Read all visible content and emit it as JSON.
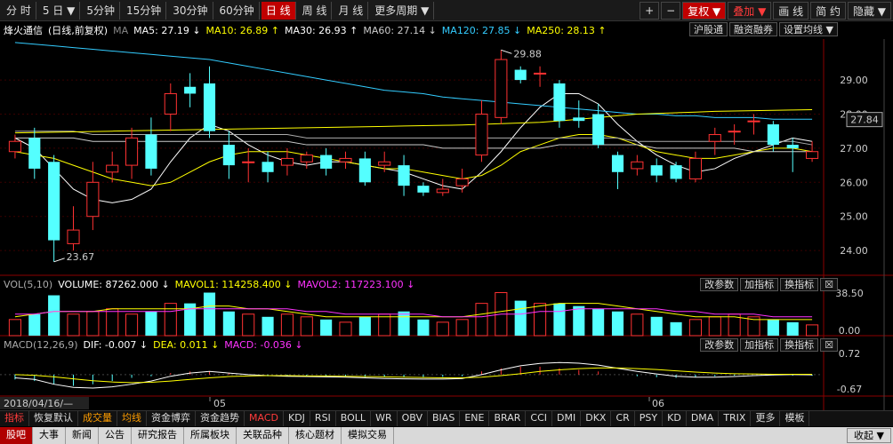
{
  "toolbar": {
    "periods": [
      "分 时",
      "5 日 ▼",
      "5分钟",
      "15分钟",
      "30分钟",
      "60分钟",
      "日 线",
      "周 线",
      "月 线",
      "更多周期 ▼"
    ],
    "active_period_index": 6,
    "right": [
      "+",
      "−",
      "复权 ▼",
      "叠加 ▼",
      "画 线",
      "简 约",
      "隐藏 ▼"
    ]
  },
  "ma": {
    "stock_name": "烽火通信",
    "mode": "(日线,前复权)",
    "ma_tag": "MA",
    "items": [
      {
        "label": "MA5: 27.19 ↓",
        "color": "#ffffff"
      },
      {
        "label": "MA10: 26.89 ↑",
        "color": "#ffff00"
      },
      {
        "label": "MA30: 26.93 ↑",
        "color": "#ffffff"
      },
      {
        "label": "MA60: 27.14 ↓",
        "color": "#cccccc"
      },
      {
        "label": "MA120: 27.85 ↓",
        "color": "#33ccff"
      },
      {
        "label": "MA250: 28.13 ↑",
        "color": "#ffff00"
      }
    ],
    "buttons": [
      "沪股通",
      "融资融券",
      "设置均线 ▼"
    ]
  },
  "price_axis": {
    "ticks": [
      {
        "value": 29.0,
        "label": "29.00"
      },
      {
        "value": 28.0,
        "label": "28.00"
      },
      {
        "value": 27.0,
        "label": "27.00"
      },
      {
        "value": 26.0,
        "label": "26.00"
      },
      {
        "value": 25.0,
        "label": "25.00"
      },
      {
        "value": 24.0,
        "label": "24.00"
      }
    ],
    "current": "27.84",
    "current_value": 27.84,
    "high_label": "29.88",
    "high_value": 29.88,
    "low_label": "23.67",
    "low_value": 23.67
  },
  "volume": {
    "title": "VOL(5,10)",
    "volume": "VOLUME: 87262.000 ↓",
    "mavol1": "MAVOL1: 114258.400 ↓",
    "mavol2": "MAVOL2: 117223.100 ↓",
    "axis_top": "38.50",
    "axis_bottom": "0.00",
    "buttons": [
      "改参数",
      "加指标",
      "换指标",
      "☒"
    ]
  },
  "macd": {
    "title": "MACD(12,26,9)",
    "dif": "DIF: -0.007 ↓",
    "dea": "DEA: 0.011 ↓",
    "macd": "MACD: -0.036 ↓",
    "axis_top": "0.72",
    "axis_bottom": "-0.67",
    "buttons": [
      "改参数",
      "加指标",
      "换指标",
      "☒"
    ]
  },
  "date_axis": {
    "date": "2018/04/16/—",
    "month1": "05",
    "month2": "06"
  },
  "tabs": [
    "指标",
    "恢复默认",
    "成交量",
    "均线",
    "资金博弈",
    "资金趋势",
    "MACD",
    "KDJ",
    "RSI",
    "BOLL",
    "WR",
    "OBV",
    "BIAS",
    "ENE",
    "BRAR",
    "CCI",
    "DMI",
    "DKX",
    "CR",
    "PSY",
    "KD",
    "DMA",
    "TRIX",
    "更多",
    "模板"
  ],
  "bottom": [
    "股吧",
    "大事",
    "新闻",
    "公告",
    "研究报告",
    "所属板块",
    "关联品种",
    "核心题材",
    "模拟交易"
  ],
  "bottom_right": [
    "收起 ▼"
  ],
  "chart_data": {
    "type": "candlestick",
    "ylim": [
      23.3,
      30.2
    ],
    "candles": [
      {
        "o": 26.9,
        "c": 27.2,
        "h": 27.4,
        "l": 26.7
      },
      {
        "o": 27.3,
        "c": 26.4,
        "h": 27.6,
        "l": 26.1
      },
      {
        "o": 26.6,
        "c": 24.3,
        "h": 26.8,
        "l": 23.67
      },
      {
        "o": 24.2,
        "c": 24.6,
        "h": 25.3,
        "l": 24.0
      },
      {
        "o": 25.0,
        "c": 26.0,
        "h": 26.6,
        "l": 24.6
      },
      {
        "o": 26.3,
        "c": 26.5,
        "h": 26.9,
        "l": 26.0
      },
      {
        "o": 26.5,
        "c": 27.3,
        "h": 27.6,
        "l": 26.1
      },
      {
        "o": 27.4,
        "c": 26.4,
        "h": 27.9,
        "l": 26.2
      },
      {
        "o": 28.0,
        "c": 28.6,
        "h": 28.9,
        "l": 27.5
      },
      {
        "o": 28.8,
        "c": 28.6,
        "h": 29.2,
        "l": 28.2
      },
      {
        "o": 28.9,
        "c": 27.5,
        "h": 29.4,
        "l": 27.3
      },
      {
        "o": 27.1,
        "c": 26.5,
        "h": 27.5,
        "l": 26.1
      },
      {
        "o": 26.6,
        "c": 26.6,
        "h": 27.0,
        "l": 26.0
      },
      {
        "o": 26.6,
        "c": 26.3,
        "h": 26.9,
        "l": 26.0
      },
      {
        "o": 26.5,
        "c": 26.7,
        "h": 27.0,
        "l": 26.2
      },
      {
        "o": 26.6,
        "c": 26.8,
        "h": 26.9,
        "l": 26.4
      },
      {
        "o": 26.8,
        "c": 26.4,
        "h": 27.0,
        "l": 26.2
      },
      {
        "o": 26.6,
        "c": 26.7,
        "h": 26.9,
        "l": 26.4
      },
      {
        "o": 26.7,
        "c": 26.0,
        "h": 26.9,
        "l": 25.9
      },
      {
        "o": 26.5,
        "c": 26.6,
        "h": 26.9,
        "l": 26.3
      },
      {
        "o": 26.5,
        "c": 25.9,
        "h": 26.8,
        "l": 25.6
      },
      {
        "o": 25.9,
        "c": 25.7,
        "h": 26.0,
        "l": 25.6
      },
      {
        "o": 25.7,
        "c": 25.8,
        "h": 26.1,
        "l": 25.6
      },
      {
        "o": 25.9,
        "c": 26.1,
        "h": 26.4,
        "l": 25.7
      },
      {
        "o": 26.8,
        "c": 28.0,
        "h": 28.4,
        "l": 26.6
      },
      {
        "o": 27.9,
        "c": 29.6,
        "h": 29.88,
        "l": 27.7
      },
      {
        "o": 29.3,
        "c": 29.0,
        "h": 29.4,
        "l": 28.9
      },
      {
        "o": 29.2,
        "c": 29.2,
        "h": 29.4,
        "l": 28.8
      },
      {
        "o": 28.9,
        "c": 27.8,
        "h": 29.0,
        "l": 27.6
      },
      {
        "o": 27.9,
        "c": 27.8,
        "h": 28.4,
        "l": 27.6
      },
      {
        "o": 28.0,
        "c": 27.1,
        "h": 28.3,
        "l": 27.0
      },
      {
        "o": 26.8,
        "c": 26.3,
        "h": 26.9,
        "l": 25.8
      },
      {
        "o": 26.4,
        "c": 26.6,
        "h": 26.8,
        "l": 26.2
      },
      {
        "o": 26.5,
        "c": 26.2,
        "h": 26.7,
        "l": 26.0
      },
      {
        "o": 26.5,
        "c": 26.1,
        "h": 26.6,
        "l": 26.0
      },
      {
        "o": 26.1,
        "c": 26.7,
        "h": 26.9,
        "l": 26.0
      },
      {
        "o": 27.2,
        "c": 27.4,
        "h": 27.6,
        "l": 26.8
      },
      {
        "o": 27.5,
        "c": 27.5,
        "h": 27.7,
        "l": 27.1
      },
      {
        "o": 27.8,
        "c": 27.8,
        "h": 28.0,
        "l": 27.4
      },
      {
        "o": 27.7,
        "c": 27.1,
        "h": 27.8,
        "l": 26.9
      },
      {
        "o": 27.1,
        "c": 27.0,
        "h": 27.3,
        "l": 26.3
      },
      {
        "o": 26.7,
        "c": 26.9,
        "h": 27.2,
        "l": 26.6
      }
    ],
    "ma_lines": [
      {
        "name": "MA5",
        "color": "#ffffff",
        "values": [
          27.3,
          27.0,
          26.4,
          25.8,
          25.5,
          25.4,
          25.5,
          25.8,
          26.6,
          27.3,
          27.7,
          27.5,
          27.1,
          26.8,
          26.6,
          26.5,
          26.6,
          26.6,
          26.5,
          26.4,
          26.3,
          26.1,
          25.9,
          25.8,
          26.3,
          26.9,
          27.6,
          28.2,
          28.6,
          28.6,
          28.3,
          27.7,
          27.2,
          26.8,
          26.5,
          26.3,
          26.4,
          26.7,
          26.9,
          27.1,
          27.3,
          27.2
        ]
      },
      {
        "name": "MA10",
        "color": "#ffff00",
        "values": [
          26.9,
          26.8,
          26.7,
          26.5,
          26.3,
          26.1,
          26.0,
          25.9,
          26.0,
          26.3,
          26.6,
          26.8,
          26.9,
          26.9,
          26.9,
          26.8,
          26.7,
          26.6,
          26.5,
          26.4,
          26.4,
          26.3,
          26.2,
          26.1,
          26.2,
          26.5,
          26.9,
          27.1,
          27.3,
          27.4,
          27.4,
          27.3,
          27.1,
          26.9,
          26.8,
          26.7,
          26.7,
          26.8,
          26.9,
          27.0,
          27.0,
          26.9
        ]
      },
      {
        "name": "MA30",
        "color": "#cccccc",
        "values": [
          27.3,
          27.3,
          27.3,
          27.3,
          27.2,
          27.2,
          27.2,
          27.2,
          27.2,
          27.2,
          27.2,
          27.2,
          27.2,
          27.2,
          27.2,
          27.1,
          27.1,
          27.1,
          27.1,
          27.1,
          27.1,
          27.1,
          27.0,
          27.0,
          27.0,
          27.0,
          27.0,
          27.0,
          27.1,
          27.1,
          27.1,
          27.1,
          27.1,
          27.0,
          27.0,
          27.0,
          27.0,
          27.0,
          26.9,
          26.9,
          26.9,
          26.9
        ]
      },
      {
        "name": "MA60",
        "color": "#aaaaaa",
        "values": [
          27.5,
          27.5,
          27.5,
          27.5,
          27.4,
          27.4,
          27.4,
          27.4,
          27.4,
          27.4,
          27.4,
          27.4,
          27.4,
          27.4,
          27.4,
          27.3,
          27.3,
          27.3,
          27.3,
          27.3,
          27.3,
          27.3,
          27.3,
          27.3,
          27.3,
          27.3,
          27.3,
          27.3,
          27.3,
          27.3,
          27.3,
          27.3,
          27.2,
          27.2,
          27.2,
          27.2,
          27.2,
          27.2,
          27.2,
          27.2,
          27.2,
          27.1
        ]
      },
      {
        "name": "MA120",
        "color": "#33ccff",
        "values": [
          30.1,
          30.05,
          30.0,
          29.95,
          29.9,
          29.85,
          29.8,
          29.75,
          29.7,
          29.65,
          29.6,
          29.5,
          29.4,
          29.3,
          29.2,
          29.1,
          29.0,
          28.9,
          28.8,
          28.7,
          28.65,
          28.6,
          28.5,
          28.45,
          28.4,
          28.35,
          28.3,
          28.25,
          28.2,
          28.15,
          28.1,
          28.05,
          28.0,
          28.0,
          27.95,
          27.95,
          27.9,
          27.9,
          27.9,
          27.85,
          27.85,
          27.85
        ]
      },
      {
        "name": "MA250",
        "color": "#ffff00",
        "values": [
          27.45,
          27.46,
          27.47,
          27.48,
          27.49,
          27.5,
          27.51,
          27.52,
          27.53,
          27.54,
          27.55,
          27.56,
          27.57,
          27.58,
          27.59,
          27.6,
          27.61,
          27.62,
          27.63,
          27.64,
          27.65,
          27.66,
          27.67,
          27.68,
          27.7,
          27.72,
          27.74,
          27.76,
          27.8,
          27.85,
          27.9,
          27.95,
          28.0,
          28.02,
          28.04,
          28.06,
          28.08,
          28.09,
          28.1,
          28.11,
          28.12,
          28.13
        ]
      }
    ],
    "volume": [
      6,
      8,
      15,
      8,
      9,
      10,
      8,
      9,
      12,
      12,
      16,
      9,
      8,
      7,
      8,
      7,
      6,
      5,
      7,
      8,
      9,
      6,
      5,
      6,
      12,
      16,
      13,
      12,
      12,
      11,
      10,
      9,
      8,
      7,
      5,
      6,
      7,
      8,
      7,
      6,
      5,
      4
    ],
    "mavol1": [
      7,
      8,
      9,
      9,
      9,
      10,
      10,
      10,
      10,
      10,
      11,
      11,
      10,
      10,
      9,
      8,
      7,
      7,
      7,
      7,
      7,
      7,
      7,
      7,
      8,
      9,
      10,
      11,
      12,
      12,
      12,
      11,
      10,
      9,
      8,
      7,
      7,
      7,
      6,
      6,
      6,
      6
    ],
    "mavol2": [
      8,
      8,
      9,
      9,
      9,
      9,
      9,
      9,
      9,
      10,
      10,
      10,
      10,
      10,
      10,
      9,
      9,
      8,
      8,
      8,
      8,
      8,
      7,
      7,
      7,
      8,
      8,
      9,
      9,
      10,
      10,
      10,
      10,
      10,
      9,
      9,
      8,
      8,
      8,
      7,
      7,
      7
    ],
    "macd_hist": [
      -0.15,
      -0.2,
      -0.3,
      -0.35,
      -0.3,
      -0.2,
      -0.1,
      -0.05,
      0.05,
      0.1,
      0.1,
      0.05,
      0.0,
      -0.05,
      -0.05,
      -0.05,
      -0.05,
      -0.06,
      -0.08,
      -0.07,
      -0.08,
      -0.08,
      -0.07,
      -0.05,
      0.1,
      0.2,
      0.25,
      0.25,
      0.2,
      0.15,
      0.1,
      0.0,
      -0.05,
      -0.08,
      -0.1,
      -0.08,
      -0.05,
      -0.03,
      0.0,
      -0.02,
      -0.03,
      -0.036
    ],
    "dif": [
      -0.1,
      -0.15,
      -0.3,
      -0.4,
      -0.42,
      -0.38,
      -0.3,
      -0.2,
      -0.05,
      0.05,
      0.1,
      0.05,
      0.0,
      -0.03,
      -0.05,
      -0.06,
      -0.07,
      -0.08,
      -0.1,
      -0.12,
      -0.13,
      -0.14,
      -0.14,
      -0.12,
      0.0,
      0.15,
      0.28,
      0.35,
      0.38,
      0.36,
      0.3,
      0.2,
      0.1,
      0.02,
      -0.05,
      -0.08,
      -0.08,
      -0.06,
      -0.03,
      -0.01,
      0.0,
      -0.007
    ],
    "dea": [
      0.0,
      -0.02,
      -0.07,
      -0.13,
      -0.19,
      -0.23,
      -0.25,
      -0.24,
      -0.2,
      -0.15,
      -0.1,
      -0.06,
      -0.04,
      -0.03,
      -0.03,
      -0.04,
      -0.04,
      -0.05,
      -0.06,
      -0.07,
      -0.08,
      -0.09,
      -0.1,
      -0.1,
      -0.08,
      -0.03,
      0.03,
      0.1,
      0.15,
      0.19,
      0.21,
      0.21,
      0.19,
      0.16,
      0.12,
      0.08,
      0.05,
      0.03,
      0.02,
      0.01,
      0.01,
      0.011
    ]
  }
}
